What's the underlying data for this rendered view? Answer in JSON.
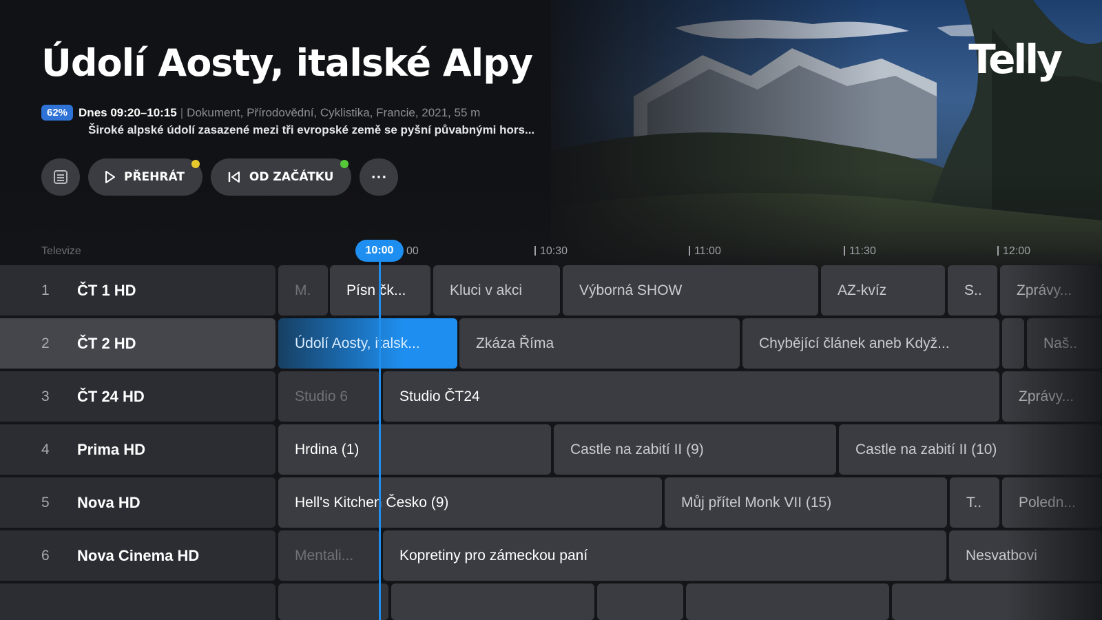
{
  "hero": {
    "title": "Údolí Aosty, italské Alpy",
    "progress_badge": "62%",
    "progress_fraction": 0.62,
    "time": "Dnes 09:20–10:15",
    "separator": "|",
    "info": "Dokument, Přírodovědní, Cyklistika, Francie, 2021, 55 m",
    "description": "Široké alpské údolí zasazené mezi tři evropské země se pyšní půvabnými hors..."
  },
  "logo": {
    "text": "Telly"
  },
  "actions": {
    "play_label": "PŘEHRÁT",
    "start_label": "OD ZAČÁTKU",
    "more_label": "···",
    "icons": [
      "list-icon",
      "play-icon",
      "skip-to-start-icon",
      "more-icon"
    ]
  },
  "timeline": {
    "section_label": "Televize",
    "now": "10:00",
    "ticks": [
      "00",
      "10:30",
      "11:00",
      "11:30",
      "12:00"
    ]
  },
  "channels": [
    {
      "number": "1",
      "name": "ČT 1 HD"
    },
    {
      "number": "2",
      "name": "ČT 2 HD"
    },
    {
      "number": "3",
      "name": "ČT 24 HD"
    },
    {
      "number": "4",
      "name": "Prima HD"
    },
    {
      "number": "5",
      "name": "Nova HD"
    },
    {
      "number": "6",
      "name": "Nova Cinema HD"
    }
  ],
  "programs": {
    "row1": [
      "M.",
      "Písn čk...",
      "Kluci v akci",
      "Výborná SHOW",
      "AZ-kvíz",
      "S..",
      "Zprávy..."
    ],
    "row2": [
      "Údolí Aosty, italsk...",
      "Zkáza Říma",
      "Chybějící článek aneb Když...",
      "",
      "Naš.."
    ],
    "row3": [
      "Studio 6",
      "Studio ČT24",
      "Zprávy..."
    ],
    "row4": [
      "Hrdina (1)",
      "Castle na zabití II (9)",
      "Castle na zabití II (10)"
    ],
    "row5": [
      "Hell's Kitchen Česko (9)",
      "Můj přítel Monk VII (15)",
      "T..",
      "Poledn..."
    ],
    "row6": [
      "Mentali...",
      "Kopretiny pro zámeckou paní",
      "Nesvatbovi"
    ]
  },
  "colors": {
    "accent": "#1e8ff0",
    "badge": "#2f73d6",
    "dot_yellow": "#e7c92e",
    "dot_green": "#55c83a"
  }
}
